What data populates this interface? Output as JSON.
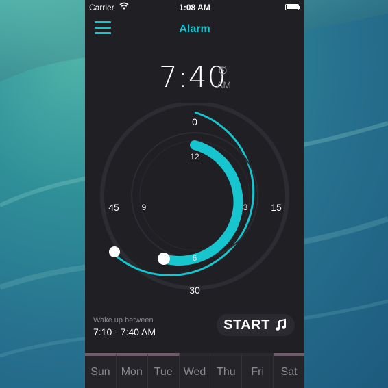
{
  "status": {
    "carrier": "Carrier",
    "time": "1:08 AM"
  },
  "nav": {
    "title": "Alarm"
  },
  "alarm": {
    "time": "7:40",
    "ampm": "AM"
  },
  "dial": {
    "outer_labels": [
      "0",
      "15",
      "30",
      "45"
    ],
    "inner_labels": [
      "12",
      "3",
      "6",
      "9"
    ],
    "accent": "#17c5cf"
  },
  "wake": {
    "label": "Wake up between",
    "range": "7:10 - 7:40 AM"
  },
  "start": {
    "label": "START"
  },
  "days": [
    {
      "label": "Sun",
      "on": true
    },
    {
      "label": "Mon",
      "on": true
    },
    {
      "label": "Tue",
      "on": true
    },
    {
      "label": "Wed",
      "on": false
    },
    {
      "label": "Thu",
      "on": false
    },
    {
      "label": "Fri",
      "on": false
    },
    {
      "label": "Sat",
      "on": true
    }
  ]
}
